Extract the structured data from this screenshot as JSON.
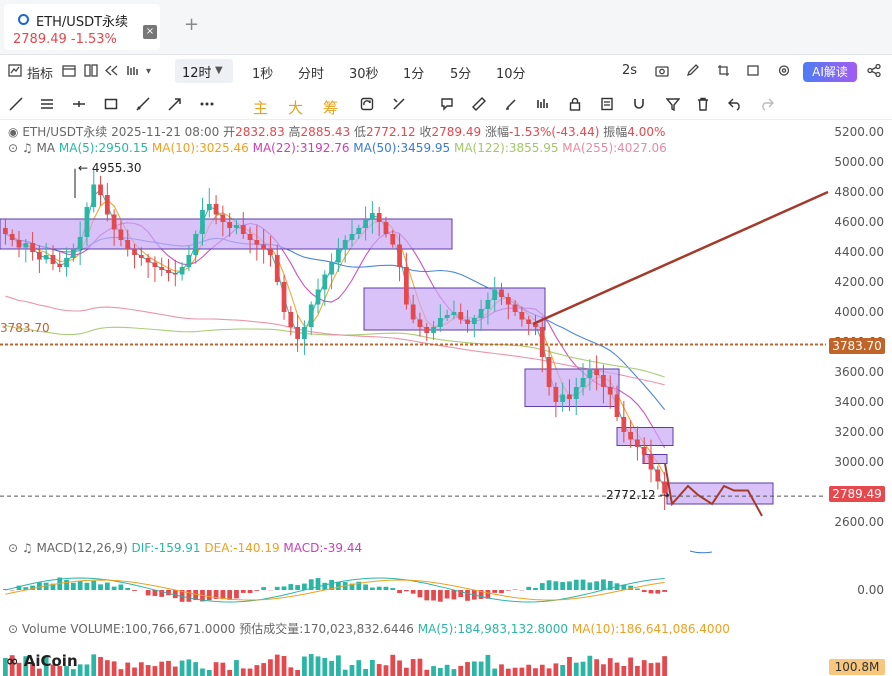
{
  "tab": {
    "title": "ETH/USDT永续",
    "price": "2789.49",
    "change": "-1.53%",
    "close_glyph": "×",
    "add_glyph": "+"
  },
  "toolbar": {
    "indicators_label": "指标",
    "interval": "12时",
    "intervals": [
      "1秒",
      "分时",
      "30秒",
      "1分",
      "5分",
      "10分"
    ],
    "refresh_label": "2s",
    "ai_label": "AI解读"
  },
  "drawbar": {
    "main_label": "主",
    "big_label": "大",
    "chip_label": "筹"
  },
  "legend": {
    "ohlc": {
      "symbol": "ETH/USDT永续",
      "datetime": "2025-11-21 08:00",
      "open_label": "开",
      "open": "2832.83",
      "high_label": "高",
      "high": "2885.43",
      "low_label": "低",
      "low": "2772.12",
      "close_label": "收",
      "close": "2789.49",
      "change_label": "涨幅",
      "change": "-1.53%(-43.44)",
      "amplitude_label": "振幅",
      "amplitude": "4.00%"
    },
    "ma": {
      "label": "MA",
      "items": [
        {
          "text": "MA(5):2950.15",
          "color": "#2bb5a5"
        },
        {
          "text": "MA(10):3025.46",
          "color": "#f0a020"
        },
        {
          "text": "MA(22):3192.76",
          "color": "#c940b7"
        },
        {
          "text": "MA(50):3459.95",
          "color": "#3a7bd5"
        },
        {
          "text": "MA(122):3855.95",
          "color": "#a3c76a"
        },
        {
          "text": "MA(255):4027.06",
          "color": "#e98aa0"
        }
      ]
    },
    "macd": {
      "label": "MACD(12,26,9)",
      "dif": "DIF:-159.91",
      "dea": "DEA:-140.19",
      "macd": "MACD:-39.44"
    },
    "volume": {
      "label": "Volume",
      "volume": "VOLUME:100,766,671.0000",
      "forecast": "预估成交量:170,023,832.6446",
      "ma5": "MA(5):184,983,132.8000",
      "ma10": "MA(10):186,641,086.4000"
    }
  },
  "annotations": {
    "high_mark": "4955.30",
    "low_mark": "2772.12",
    "level_left": "3783.70"
  },
  "price_axis": [
    "5200.00",
    "5000.00",
    "4800.00",
    "4600.00",
    "4400.00",
    "4200.00",
    "4000.00",
    "3800.00",
    "3600.00",
    "3400.00",
    "3200.00",
    "3000.00",
    "2800.00",
    "2600.00"
  ],
  "price_tags": {
    "level": "3783.70",
    "current": "2789.49",
    "level_color": "#c0642a",
    "current_color": "#e5484d"
  },
  "macd_axis": "0.00",
  "volume_tag": "100.8M",
  "logo": "AiCoin",
  "colors": {
    "up": "#2bb5a5",
    "down": "#e5484d",
    "box": "#c9a8f5",
    "trend": "#a33a2a",
    "level": "#c0642a"
  },
  "chart_data": {
    "type": "candlestick",
    "title": "ETH/USDT永续",
    "interval": "12时",
    "ylim": [
      2500,
      5300
    ],
    "series": [
      {
        "name": "MA(5)",
        "last": 2950.15
      },
      {
        "name": "MA(10)",
        "last": 3025.46
      },
      {
        "name": "MA(22)",
        "last": 3192.76
      },
      {
        "name": "MA(50)",
        "last": 3459.95
      },
      {
        "name": "MA(122)",
        "last": 3855.95
      },
      {
        "name": "MA(255)",
        "last": 4027.06
      }
    ],
    "approx_close": [
      4520,
      4480,
      4430,
      4460,
      4400,
      4350,
      4380,
      4320,
      4300,
      4360,
      4420,
      4500,
      4700,
      4850,
      4780,
      4650,
      4550,
      4480,
      4420,
      4380,
      4360,
      4330,
      4300,
      4280,
      4260,
      4250,
      4300,
      4380,
      4520,
      4680,
      4720,
      4650,
      4600,
      4560,
      4580,
      4520,
      4480,
      4450,
      4420,
      4380,
      4200,
      4000,
      3900,
      3820,
      3900,
      4050,
      4150,
      4250,
      4330,
      4420,
      4480,
      4520,
      4560,
      4620,
      4660,
      4600,
      4520,
      4450,
      4300,
      4050,
      3950,
      3900,
      3860,
      3900,
      3960,
      3980,
      4000,
      3950,
      3920,
      3960,
      4020,
      4080,
      4150,
      4100,
      4050,
      4000,
      3950,
      3920,
      3900,
      3700,
      3500,
      3400,
      3450,
      3420,
      3500,
      3560,
      3620,
      3580,
      3500,
      3450,
      3300,
      3200,
      3150,
      3100,
      3050,
      2950,
      2870,
      2789.49
    ],
    "boxes": [
      {
        "from": 4420,
        "to": 4620
      },
      {
        "from": 3880,
        "to": 4160
      },
      {
        "from": 3370,
        "to": 3620
      },
      {
        "from": 3110,
        "to": 3230
      },
      {
        "from": 2990,
        "to": 3050
      },
      {
        "from": 2720,
        "to": 2860
      }
    ],
    "horizontal_levels": [
      3783.7,
      2772.12
    ],
    "macd": {
      "dif": -159.91,
      "dea": -140.19,
      "macd": -39.44
    },
    "volume": {
      "last": 100766671.0,
      "forecast": 170023832.6446,
      "ma5": 184983132.8,
      "ma10": 186641086.4
    }
  }
}
